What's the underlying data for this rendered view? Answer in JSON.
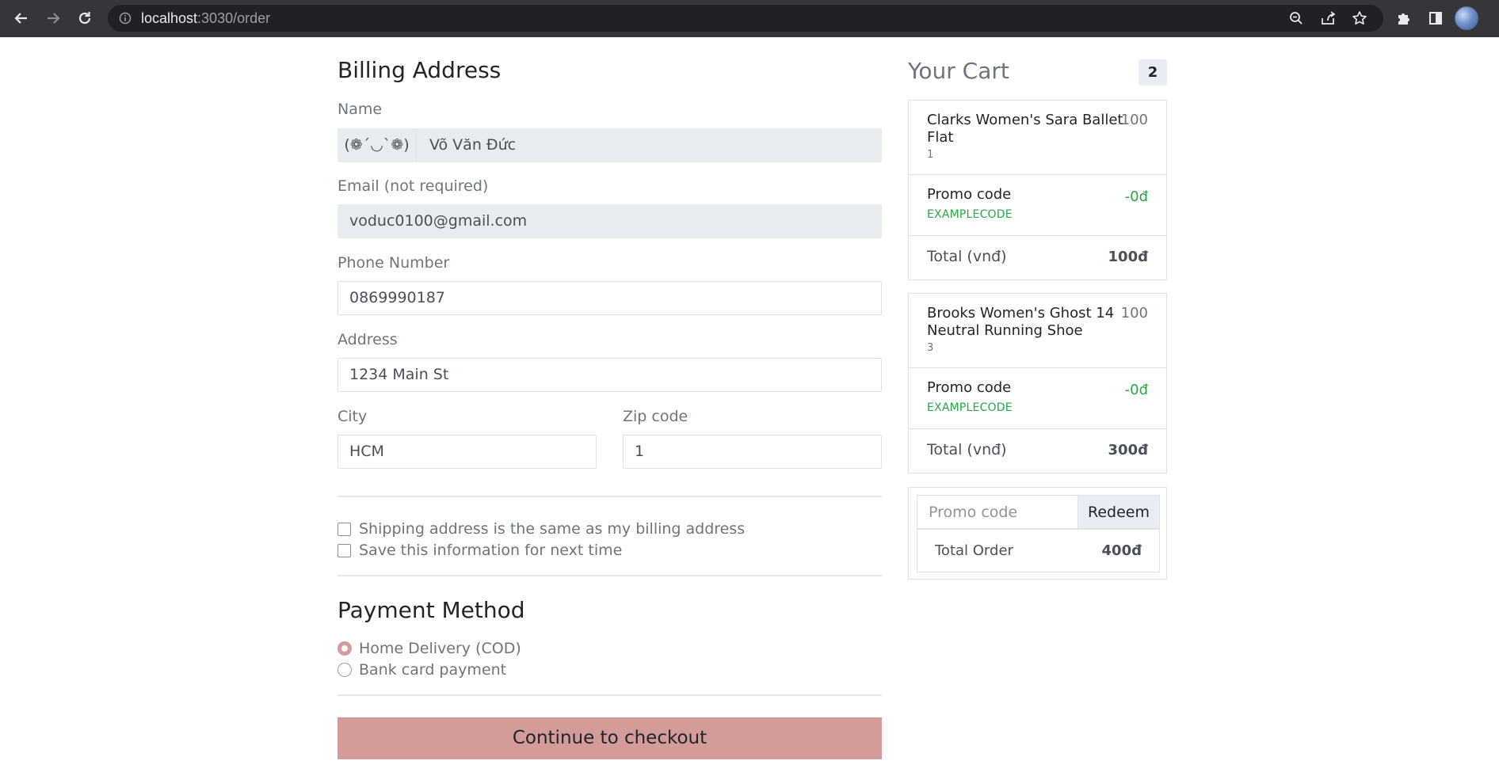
{
  "browser": {
    "url_host": "localhost",
    "url_path": ":3030/order"
  },
  "billing": {
    "title": "Billing Address",
    "name_label": "Name",
    "name_prefix": "(❁´◡`❁)",
    "name_value": "Võ Văn Đức",
    "email_label": "Email (not required)",
    "email_value": "voduc0100@gmail.com",
    "phone_label": "Phone Number",
    "phone_value": "0869990187",
    "address_label": "Address",
    "address_value": "1234 Main St",
    "city_label": "City",
    "city_value": "HCM",
    "zip_label": "Zip code",
    "zip_value": "1"
  },
  "options": {
    "same_address": "Shipping address is the same as my billing address",
    "save_info": "Save this information for next time"
  },
  "payment": {
    "title": "Payment Method",
    "options": [
      {
        "label": "Home Delivery (COD)",
        "selected": true
      },
      {
        "label": "Bank card payment",
        "selected": false
      }
    ],
    "accent_color": "#d39c9a"
  },
  "checkout_button": "Continue to checkout",
  "cart": {
    "title": "Your Cart",
    "count": "2",
    "items": [
      {
        "name": "Clarks Women's Sara Ballet Flat",
        "quantity": "1",
        "price": "100",
        "promo_label": "Promo code",
        "promo_code": "EXAMPLECODE",
        "promo_value": "-0đ",
        "total_label": "Total (vnđ)",
        "total_value": "100đ"
      },
      {
        "name": "Brooks Women's Ghost 14 Neutral Running Shoe",
        "quantity": "3",
        "price": "100",
        "promo_label": "Promo code",
        "promo_code": "EXAMPLECODE",
        "promo_value": "-0đ",
        "total_label": "Total (vnđ)",
        "total_value": "300đ"
      }
    ],
    "promo_placeholder": "Promo code",
    "redeem_label": "Redeem",
    "order_total_label": "Total Order",
    "order_total_value": "400đ"
  }
}
